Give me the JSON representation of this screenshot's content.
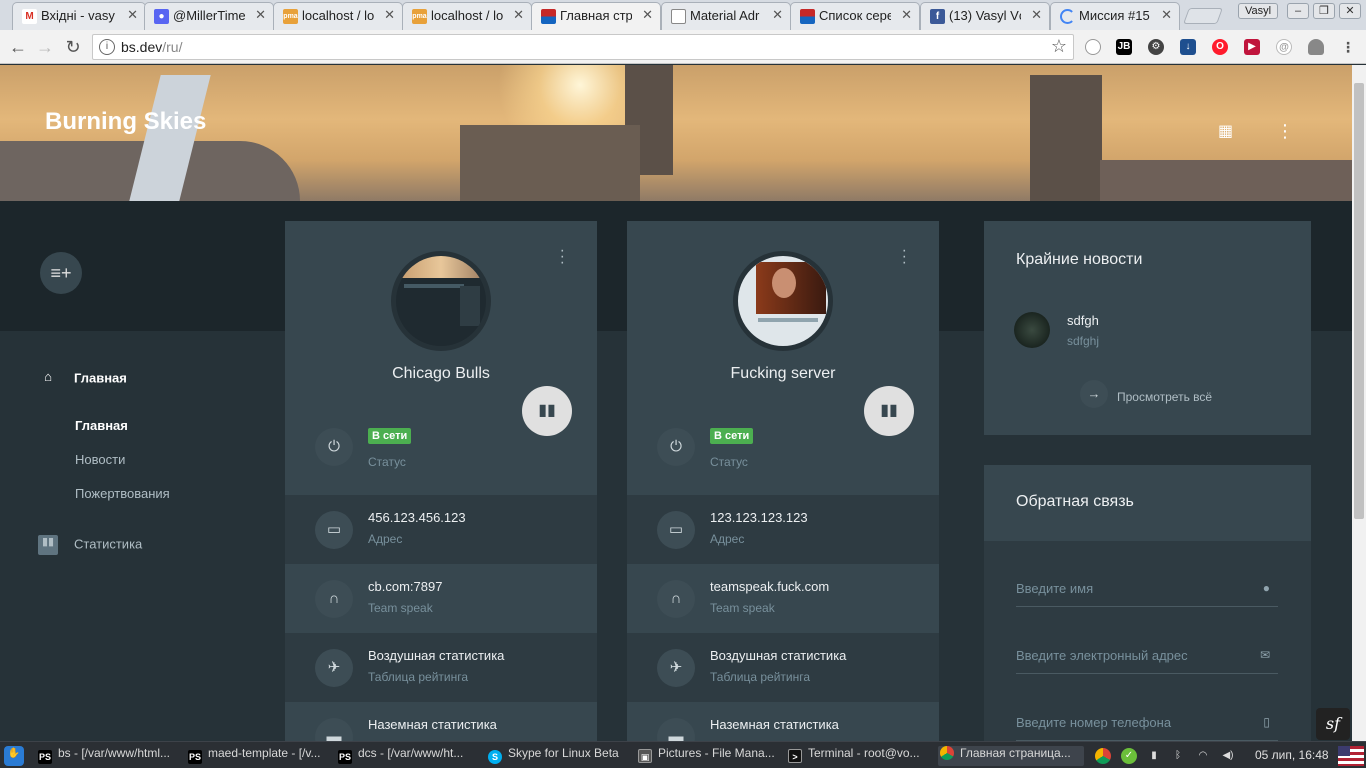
{
  "browser": {
    "tabs": [
      {
        "title": "Вхідні - vasy",
        "icon": "gmail-icon",
        "color": "#d93025",
        "glyph": "M"
      },
      {
        "title": "@MillerTime",
        "icon": "discord-icon",
        "color": "#5865f2",
        "glyph": "●"
      },
      {
        "title": "localhost / lo",
        "icon": "phpmyadmin-icon",
        "color": "#e8a13a",
        "glyph": "pma"
      },
      {
        "title": "localhost / lo",
        "icon": "phpmyadmin-icon",
        "color": "#e8a13a",
        "glyph": "pma"
      },
      {
        "title": "Главная стр",
        "icon": "site-flag-icon",
        "color": "#c62828",
        "glyph": "▀"
      },
      {
        "title": "Material Adr",
        "icon": "page-icon",
        "color": "#9e9e9e",
        "glyph": "▯"
      },
      {
        "title": "Список сере",
        "icon": "site-flag-icon",
        "color": "#c62828",
        "glyph": "▀"
      },
      {
        "title": "(13) Vasyl Vc",
        "icon": "facebook-icon",
        "color": "#3b5998",
        "glyph": "f"
      },
      {
        "title": "Миссия #15",
        "icon": "loading-icon",
        "color": "#4285f4",
        "glyph": "◌"
      }
    ],
    "user": "Vasyl",
    "url_host": "bs.dev",
    "url_path": "/ru/"
  },
  "site": {
    "title": "Burning Skies"
  },
  "sidebar": {
    "home": "Главная",
    "sub": [
      "Главная",
      "Новости",
      "Пожертвования"
    ],
    "stats": "Статистика"
  },
  "servers": [
    {
      "name": "Chicago Bulls",
      "status": "В сети",
      "status_label": "Статус",
      "address": "456.123.456.123",
      "address_label": "Адрес",
      "ts": "cb.com:7897",
      "ts_label": "Team speak",
      "air": "Воздушная статистика",
      "air_label": "Таблица рейтинга",
      "ground": "Наземная статистика"
    },
    {
      "name": "Fucking server",
      "status": "В сети",
      "status_label": "Статус",
      "address": "123.123.123.123",
      "address_label": "Адрес",
      "ts": "teamspeak.fuck.com",
      "ts_label": "Team speak",
      "air": "Воздушная статистика",
      "air_label": "Таблица рейтинга",
      "ground": "Наземная статистика"
    }
  ],
  "news": {
    "heading": "Крайние новости",
    "item_title": "sdfgh",
    "item_sub": "sdfghj",
    "view_all": "Просмотреть всё"
  },
  "feedback": {
    "heading": "Обратная связь",
    "name_placeholder": "Введите имя",
    "email_placeholder": "Введите электронный адрес",
    "phone_placeholder": "Введите номер телефона"
  },
  "taskbar": {
    "tasks": [
      {
        "label": "bs - [/var/www/html...",
        "icon": "phpstorm-icon"
      },
      {
        "label": "maed-template - [/v...",
        "icon": "phpstorm-icon"
      },
      {
        "label": "dcs - [/var/www/ht...",
        "icon": "phpstorm-icon"
      },
      {
        "label": "Skype for Linux Beta",
        "icon": "skype-icon"
      },
      {
        "label": "Pictures - File Mana...",
        "icon": "file-manager-icon"
      },
      {
        "label": "Terminal - root@vo...",
        "icon": "terminal-icon"
      },
      {
        "label": "Главная страница...",
        "icon": "chrome-icon"
      }
    ],
    "clock": "05 лип, 16:48"
  },
  "colors": {
    "bg": "#263238",
    "card": "#37474f",
    "online": "#4caf50"
  }
}
